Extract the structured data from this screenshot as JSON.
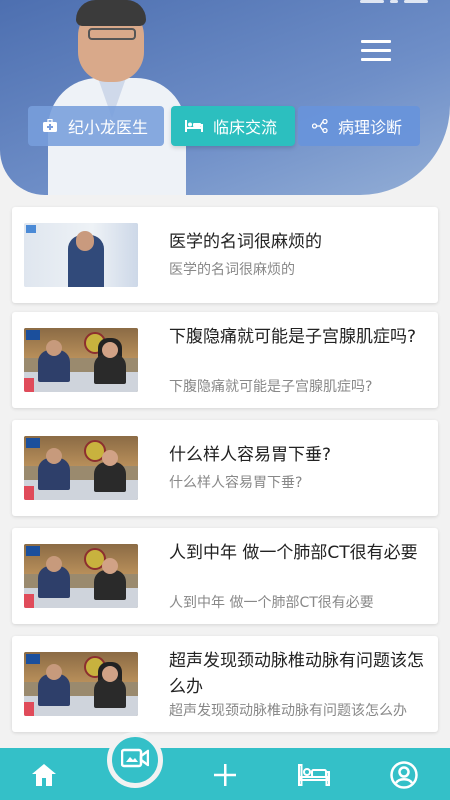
{
  "header": {
    "tabs": [
      {
        "label": "纪小龙医生",
        "icon": "medical-kit-icon"
      },
      {
        "label": "临床交流",
        "icon": "hospital-bed-icon"
      },
      {
        "label": "病理诊断",
        "icon": "share-tree-icon"
      }
    ],
    "menu_icon": "hamburger-menu-icon"
  },
  "articles": [
    {
      "title": "医学的名词很麻烦的",
      "subtitle": "医学的名词很麻烦的"
    },
    {
      "title": "下腹隐痛就可能是子宫腺肌症吗?",
      "subtitle": "下腹隐痛就可能是子宫腺肌症吗?"
    },
    {
      "title": "什么样人容易胃下垂?",
      "subtitle": "什么样人容易胃下垂?"
    },
    {
      "title": "人到中年 做一个肺部CT很有必要",
      "subtitle": "人到中年 做一个肺部CT很有必要"
    },
    {
      "title": "超声发现颈动脉椎动脉有问题该怎么办",
      "subtitle": "超声发现颈动脉椎动脉有问题该怎么办"
    }
  ],
  "bottom_nav": {
    "items": [
      "home-icon",
      "video-icon",
      "add-icon",
      "bed-icon",
      "profile-icon"
    ]
  },
  "colors": {
    "accent": "#34c0c8",
    "header": "#5b7dbd",
    "tab_active": "#2cbfbf"
  }
}
